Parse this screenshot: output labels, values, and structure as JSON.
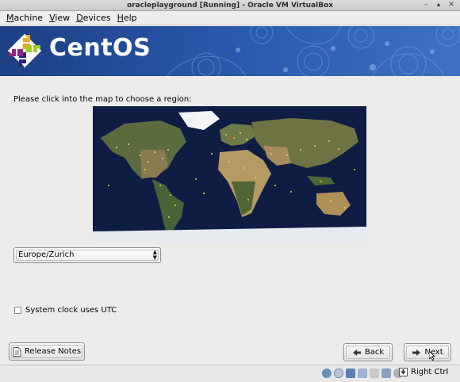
{
  "window": {
    "title": "oracleplayground [Running] - Oracle VM VirtualBox",
    "controls": [
      "minimize-icon",
      "maximize-icon",
      "close-icon"
    ]
  },
  "menu": {
    "items": [
      {
        "label": "Machine",
        "accel": "M"
      },
      {
        "label": "View",
        "accel": "V"
      },
      {
        "label": "Devices",
        "accel": "D"
      },
      {
        "label": "Help",
        "accel": "H"
      }
    ]
  },
  "banner": {
    "brand": "CentOS",
    "colors": {
      "primary": "#2b5bb0",
      "dark": "#1d3f84"
    }
  },
  "installer": {
    "prompt": "Please click into the map to choose a region:",
    "map": {
      "icon": "world-map"
    },
    "timezone": {
      "selected": "Europe/Zurich"
    },
    "utc": {
      "label": "System clock uses UTC",
      "checked": false
    },
    "buttons": {
      "release_notes": "Release Notes",
      "back": "Back",
      "next": "Next"
    }
  },
  "statusbar": {
    "icons": [
      "hard-disk-icon",
      "optical-drive-icon",
      "network-icon",
      "usb-icon",
      "shared-folder-icon",
      "display-icon",
      "mouse-integration-icon",
      "host-key-arrow-icon"
    ],
    "host_key": "Right Ctrl"
  }
}
